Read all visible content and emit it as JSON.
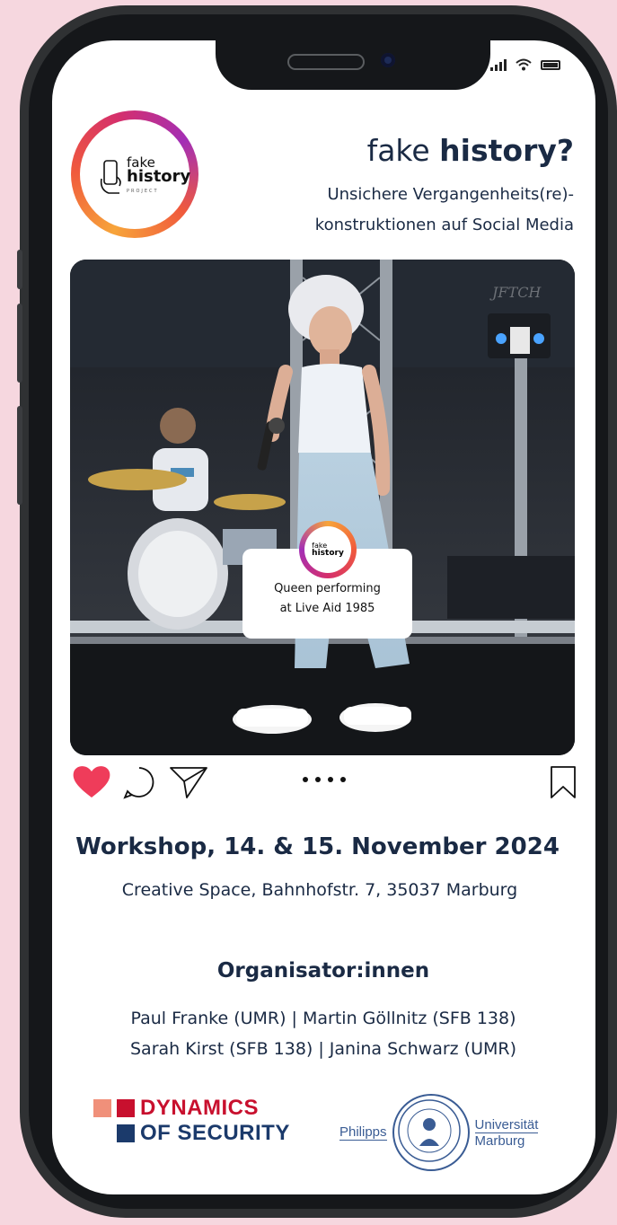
{
  "header": {
    "title_light": "fake",
    "title_bold": "history?",
    "subtitle_line1": "Unsichere Vergangenheits(re)-",
    "subtitle_line2": "konstruktionen auf Social Media"
  },
  "logo": {
    "line1": "fake",
    "line2": "history",
    "line3": "PROJECT"
  },
  "post": {
    "photo_watermark": "JFTCH",
    "caption_line1": "Queen performing",
    "caption_line2": "at Live Aid 1985",
    "caption_logo1": "fake",
    "caption_logo2": "history"
  },
  "event": {
    "title": "Workshop, 14. & 15. November 2024",
    "location": "Creative Space, Bahnhofstr. 7, 35037 Marburg"
  },
  "organizers": {
    "heading": "Organisator:innen",
    "line1": "Paul Franke (UMR) | Martin Göllnitz (SFB 138)",
    "line2": "Sarah Kirst (SFB 138) | Janina Schwarz (UMR)"
  },
  "sponsors": {
    "dos_line1": "DYNAMICS",
    "dos_line2": "OF SECURITY",
    "uni_left": "Philipps",
    "uni_right1": "Universität",
    "uni_right2": "Marburg"
  },
  "colors": {
    "background": "#f6d7df",
    "navy": "#1a2a44",
    "heart": "#ef3c5a",
    "dos_red": "#c8102e",
    "dos_navy": "#1b3a6b",
    "uni_blue": "#3a5c94"
  },
  "icons": [
    "heart-icon",
    "comment-icon",
    "send-icon",
    "more-dots-icon",
    "bookmark-icon",
    "signal-icon",
    "wifi-icon",
    "battery-icon"
  ]
}
